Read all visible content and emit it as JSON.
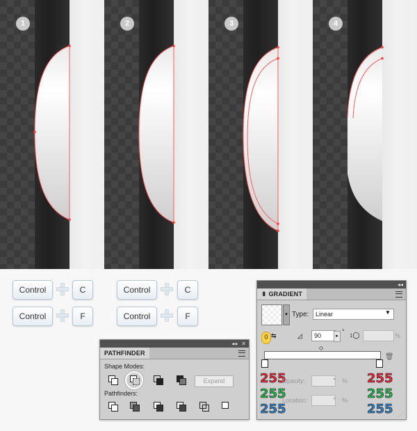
{
  "steps": [
    "1",
    "2",
    "3",
    "4"
  ],
  "keys": {
    "left": [
      {
        "modifier": "Control",
        "key": "C"
      },
      {
        "modifier": "Control",
        "key": "F"
      }
    ],
    "right": [
      {
        "modifier": "Control",
        "key": "C"
      },
      {
        "modifier": "Control",
        "key": "F"
      }
    ]
  },
  "pathfinder": {
    "title": "PATHFINDER",
    "shape_modes_label": "Shape Modes:",
    "pathfinders_label": "Pathfinders:",
    "expand_label": "Expand",
    "shape_mode_icons": [
      "unite-icon",
      "minus-front-icon",
      "intersect-icon",
      "exclude-icon"
    ],
    "pathfinder_icons": [
      "divide-icon",
      "trim-icon",
      "merge-icon",
      "crop-icon",
      "outline-icon",
      "minus-back-icon"
    ],
    "highlighted": "minus-front-icon"
  },
  "gradient": {
    "title": "GRADIENT",
    "type_label": "Type:",
    "type_value": "Linear",
    "angle_value": "90",
    "degree_symbol": "°",
    "percent_symbol": "%",
    "opacity_label": "Opacity:",
    "location_label": "Location:",
    "stop_marker": "0",
    "left_stop_rgb": [
      "255",
      "255",
      "255"
    ],
    "right_stop_rgb": [
      "255",
      "255",
      "255"
    ],
    "colors": {
      "red": "#e8273a",
      "green": "#23b24b",
      "blue": "#2e7ec1"
    }
  }
}
